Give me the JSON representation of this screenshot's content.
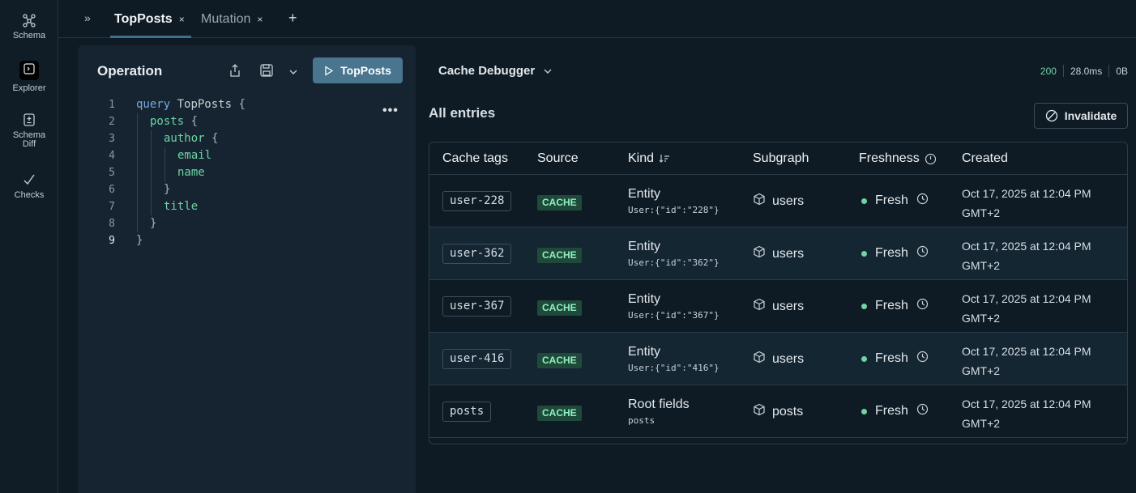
{
  "nav": {
    "items": [
      {
        "label": "Schema",
        "icon": "schema-graph-icon"
      },
      {
        "label": "Explorer",
        "icon": "explorer-terminal-icon"
      },
      {
        "label": "Schema Diff",
        "icon": "schema-diff-icon"
      },
      {
        "label": "Checks",
        "icon": "checkmark-icon"
      }
    ]
  },
  "tabs": {
    "items": [
      {
        "label": "TopPosts",
        "active": true
      },
      {
        "label": "Mutation",
        "active": false
      }
    ],
    "close_glyph": "×",
    "add_glyph": "+",
    "toggle_glyph": "»"
  },
  "operation": {
    "title": "Operation",
    "run_label": "TopPosts",
    "more_glyph": "•••",
    "lines": [
      {
        "n": "1",
        "indent": 0,
        "tokens": [
          [
            "kw",
            "query"
          ],
          [
            "nm",
            " TopPosts "
          ],
          [
            "pn",
            "{"
          ]
        ]
      },
      {
        "n": "2",
        "indent": 1,
        "tokens": [
          [
            "fld",
            "posts"
          ],
          [
            "pn",
            " {"
          ]
        ]
      },
      {
        "n": "3",
        "indent": 2,
        "tokens": [
          [
            "fld",
            "author"
          ],
          [
            "pn",
            " {"
          ]
        ]
      },
      {
        "n": "4",
        "indent": 3,
        "tokens": [
          [
            "fld",
            "email"
          ]
        ]
      },
      {
        "n": "5",
        "indent": 3,
        "tokens": [
          [
            "fld",
            "name"
          ]
        ]
      },
      {
        "n": "6",
        "indent": 2,
        "tokens": [
          [
            "pn",
            "}"
          ]
        ]
      },
      {
        "n": "7",
        "indent": 2,
        "tokens": [
          [
            "fld",
            "title"
          ]
        ]
      },
      {
        "n": "8",
        "indent": 1,
        "tokens": [
          [
            "pn",
            "}"
          ]
        ]
      },
      {
        "n": "9",
        "indent": 0,
        "tokens": [
          [
            "pn",
            "}"
          ]
        ]
      }
    ]
  },
  "response": {
    "view_label": "Cache Debugger",
    "status": "200",
    "duration": "28.0ms",
    "size": "0B"
  },
  "entries": {
    "title": "All entries",
    "invalidate_label": "Invalidate",
    "columns": [
      "Cache tags",
      "Source",
      "Kind",
      "Subgraph",
      "Freshness",
      "Created"
    ],
    "rows": [
      {
        "tag": "user-228",
        "source": "CACHE",
        "kind": "Entity",
        "key": "User:{\"id\":\"228\"}",
        "subgraph": "users",
        "freshness": "Fresh",
        "created_1": "Oct 17, 2025 at 12:04 PM",
        "created_2": "GMT+2"
      },
      {
        "tag": "user-362",
        "source": "CACHE",
        "kind": "Entity",
        "key": "User:{\"id\":\"362\"}",
        "subgraph": "users",
        "freshness": "Fresh",
        "created_1": "Oct 17, 2025 at 12:04 PM",
        "created_2": "GMT+2"
      },
      {
        "tag": "user-367",
        "source": "CACHE",
        "kind": "Entity",
        "key": "User:{\"id\":\"367\"}",
        "subgraph": "users",
        "freshness": "Fresh",
        "created_1": "Oct 17, 2025 at 12:04 PM",
        "created_2": "GMT+2"
      },
      {
        "tag": "user-416",
        "source": "CACHE",
        "kind": "Entity",
        "key": "User:{\"id\":\"416\"}",
        "subgraph": "users",
        "freshness": "Fresh",
        "created_1": "Oct 17, 2025 at 12:04 PM",
        "created_2": "GMT+2"
      },
      {
        "tag": "posts",
        "source": "CACHE",
        "kind": "Root fields",
        "key": "posts",
        "subgraph": "posts",
        "freshness": "Fresh",
        "created_1": "Oct 17, 2025 at 12:04 PM",
        "created_2": "GMT+2"
      }
    ]
  },
  "colors": {
    "accent": "#49758f",
    "fresh": "#6fd3a6",
    "cache_badge_bg": "#1f4a3a",
    "cache_badge_fg": "#8ff0c2"
  }
}
